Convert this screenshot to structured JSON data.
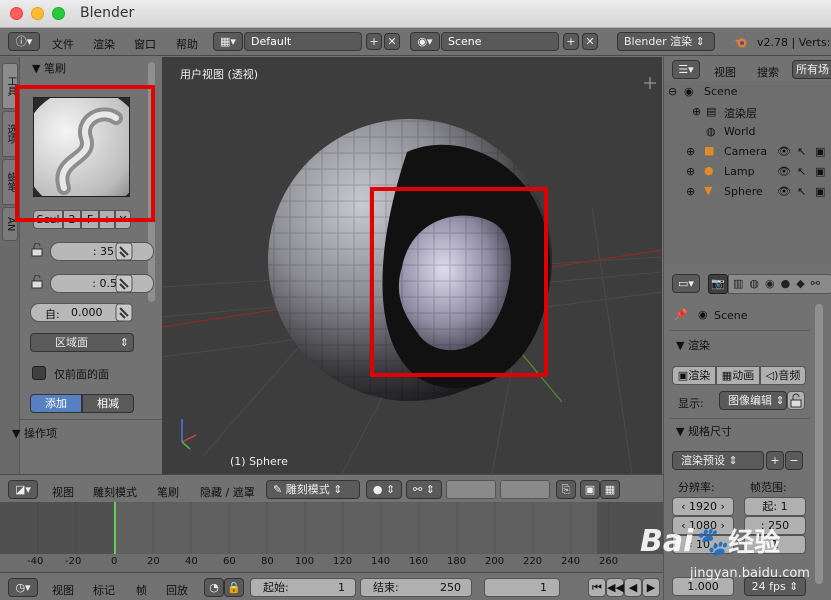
{
  "window": {
    "title": "Blender"
  },
  "infobar": {
    "menus": [
      "文件",
      "渲染",
      "窗口",
      "帮助"
    ],
    "layout": "Default",
    "scene": "Scene",
    "engine": "Blender 渲染",
    "version": "v2.78 | Verts:"
  },
  "toolshelf": {
    "tabs": [
      "工具",
      "选项",
      "蜡笔",
      "AN"
    ],
    "brush_header": "笔刷",
    "brush_name_stub": "Scul",
    "brush_num": "2",
    "brush_f": "F",
    "radius": ": 35 px",
    "strength": ": 0.500",
    "autosmooth_label": "自:",
    "autosmooth": "0.000",
    "area_select": "区域面",
    "front_faces": "仅前面的面",
    "add_label": "添加",
    "subtract_label": "相减",
    "operator_header": "操作项"
  },
  "viewport": {
    "label": "用户视图 (透视)",
    "object_label": "(1) Sphere"
  },
  "outliner": {
    "view_menu": "视图",
    "search_menu": "搜索",
    "filter": "所有场",
    "items": [
      {
        "label": "Scene",
        "indent": 0
      },
      {
        "label": "渲染层",
        "indent": 1
      },
      {
        "label": "World",
        "indent": 1
      },
      {
        "label": "Camera",
        "indent": 1
      },
      {
        "label": "Lamp",
        "indent": 1
      },
      {
        "label": "Sphere",
        "indent": 1
      }
    ]
  },
  "properties": {
    "scene_name": "Scene",
    "render_header": "渲染",
    "render_btn": "渲染",
    "anim_btn": "动画",
    "audio_btn": "音频",
    "display_label": "显示:",
    "display_value": "图像编辑",
    "dimensions_header": "规格尺寸",
    "preset": "渲染预设",
    "resolution_label": "分辨率:",
    "frame_range_label": "帧范围:",
    "res_x": "1920",
    "res_y": "1080",
    "res_pct": "10",
    "start": "起: 1",
    "end": ": 250",
    "step": "1",
    "aspect": "1.000",
    "fps": "24 fps"
  },
  "viewport_header": {
    "menus": [
      "视图",
      "雕刻模式",
      "笔刷",
      "隐藏 / 遮罩"
    ],
    "mode": "雕刻模式"
  },
  "timeline": {
    "ticks": [
      "-40",
      "-20",
      "0",
      "20",
      "40",
      "60",
      "80",
      "100",
      "120",
      "140",
      "160",
      "180",
      "200",
      "220",
      "240",
      "260"
    ],
    "current_frame": 0
  },
  "timeline_header": {
    "menus": [
      "视图",
      "标记",
      "帧",
      "回放"
    ],
    "start": "起始:",
    "start_val": "1",
    "end": "结束:",
    "end_val": "250",
    "current": "1"
  },
  "watermark": {
    "brand": "Bai",
    "brand_cn": "经验",
    "url": "jingyan.baidu.com"
  },
  "colors": {
    "annotation": "#e00000",
    "active_blue": "#5680c2",
    "frame_line": "#5bd35b"
  }
}
